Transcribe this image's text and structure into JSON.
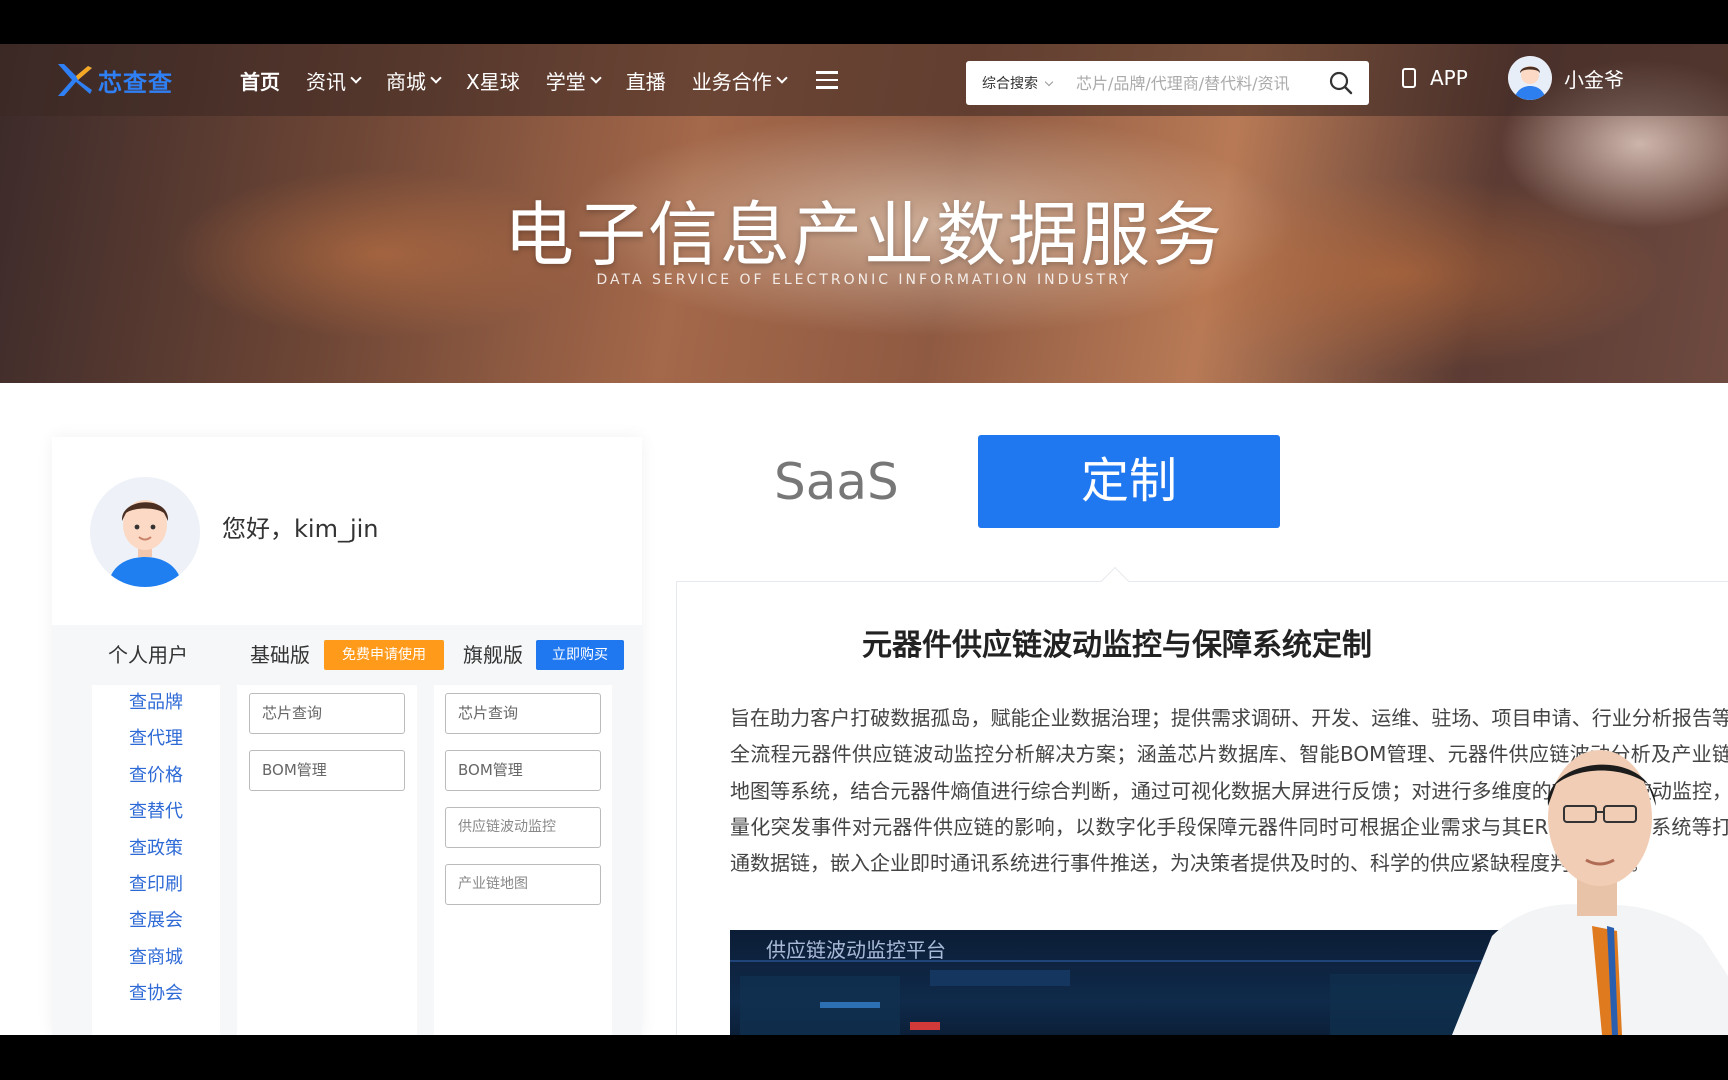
{
  "nav": {
    "brand": "芯查查",
    "items": [
      {
        "label": "首页",
        "dropdown": false,
        "active": true
      },
      {
        "label": "资讯",
        "dropdown": true
      },
      {
        "label": "商城",
        "dropdown": true
      },
      {
        "label": "X星球",
        "dropdown": false
      },
      {
        "label": "学堂",
        "dropdown": true
      },
      {
        "label": "直播",
        "dropdown": false
      },
      {
        "label": "业务合作",
        "dropdown": true
      }
    ],
    "search_type": "综合搜索",
    "search_placeholder": "芯片/品牌/代理商/替代料/资讯",
    "app_label": "APP",
    "user_name": "小金爷"
  },
  "banner": {
    "title": "电子信息产业数据服务",
    "subtitle": "DATA SERVICE OF ELECTRONIC INFORMATION INDUSTRY"
  },
  "profile": {
    "greeting": "您好，kim_jin"
  },
  "plans": {
    "personal_label": "个人用户",
    "basic_label": "基础版",
    "basic_badge": "免费申请使用",
    "flagship_label": "旗舰版",
    "flagship_badge": "立即购买",
    "personal_items": [
      "查品牌",
      "查代理",
      "查价格",
      "查替代",
      "查政策",
      "查印刷",
      "查展会",
      "查商城",
      "查协会"
    ],
    "basic_items": [
      "芯片查询",
      "BOM管理"
    ],
    "flagship_items": [
      "芯片查询",
      "BOM管理",
      "供应链波动监控",
      "产业链地图"
    ]
  },
  "tabs": {
    "saas": "SaaS",
    "custom": "定制"
  },
  "panel": {
    "title": "元器件供应链波动监控与保障系统定制",
    "description": "旨在助力客户打破数据孤岛，赋能企业数据治理；提供需求调研、开发、运维、驻场、项目申请、行业分析报告等全流程元器件供应链波动监控分析解决方案；涵盖芯片数据库、智能BOM管理、元器件供应链波动分析及产业链地图等系统，结合元器件熵值进行综合判断，通过可视化数据大屏进行反馈；对进行多维度的市场行情波动监控，量化突发事件对元器件供应链的影响，以数字化手段保障元器件同时可根据企业需求与其ERP系统、OA系统等打通数据链，嵌入企业即时通讯系统进行事件推送，为决策者提供及时的、科学的供应紧缺程度判断依据。",
    "preview_title": "供应链波动监控平台"
  },
  "colors": {
    "brand_blue": "#1f78f0",
    "badge_orange": "#ff9a1a",
    "link_blue": "#2e6ad6"
  }
}
